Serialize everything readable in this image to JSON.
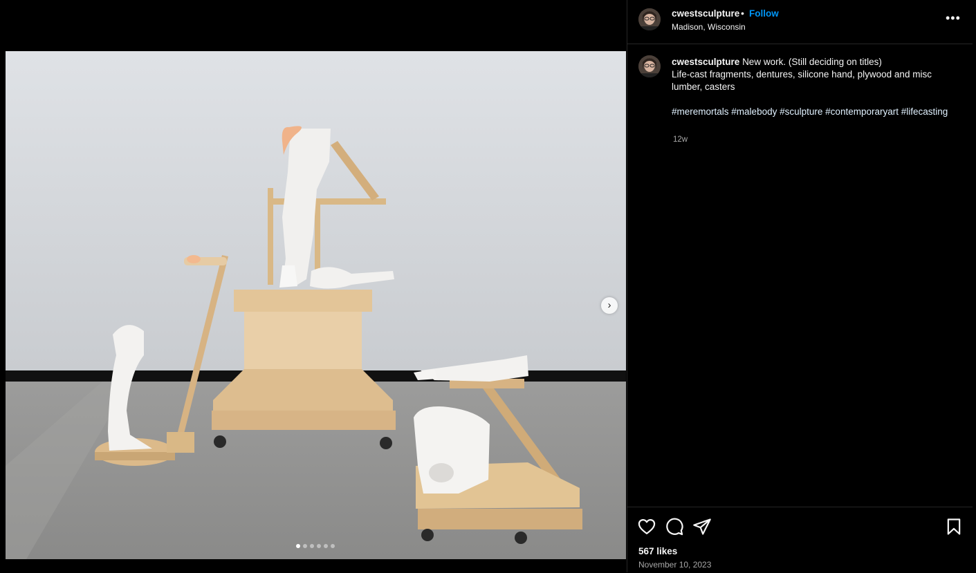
{
  "post": {
    "username": "cwestsculpture",
    "separator": "•",
    "follow_label": "Follow",
    "location": "Madison, Wisconsin",
    "more_label": "•••",
    "caption_line1": "New work. (Still deciding on titles)",
    "caption_line2": "Life-cast fragments, dentures, silicone hand, plywood and misc lumber, casters",
    "hashtags": [
      "#meremortals",
      "#malebody",
      "#sculpture",
      "#contemporaryart",
      "#lifecasting"
    ],
    "age": "12w",
    "likes": "567 likes",
    "date": "November 10, 2023"
  },
  "carousel": {
    "count": 6,
    "active": 1,
    "next_icon": "chevron-right-icon"
  },
  "icons": [
    "heart-icon",
    "comment-icon",
    "share-icon",
    "bookmark-icon",
    "more-icon"
  ],
  "colors": {
    "follow": "#0095f6",
    "background": "#000000",
    "secondary_text": "#a8a8a8"
  }
}
